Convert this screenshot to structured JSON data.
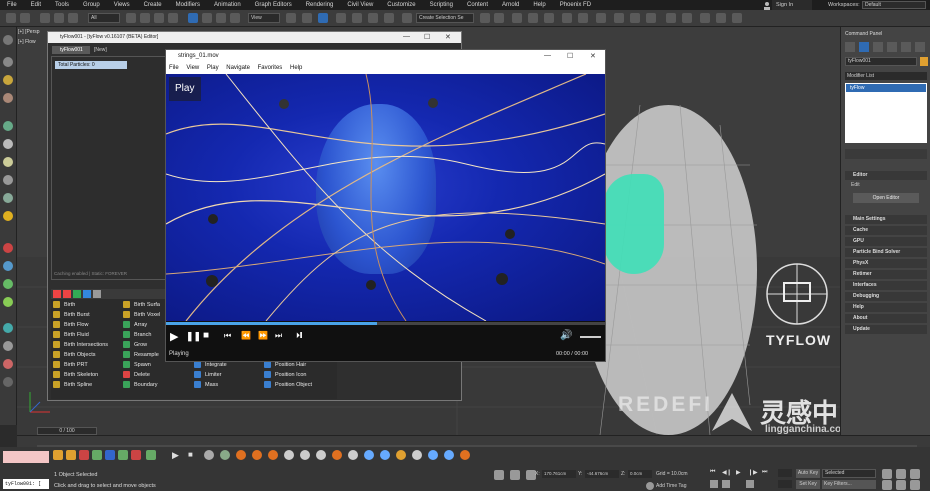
{
  "menubar": {
    "items": [
      "File",
      "Edit",
      "Tools",
      "Group",
      "Views",
      "Create",
      "Modifiers",
      "Animation",
      "Graph Editors",
      "Rendering",
      "Civil View",
      "Customize",
      "Scripting",
      "Content",
      "Arnold",
      "Help",
      "Phoenix FD"
    ],
    "signin": "Sign In",
    "workspaces_label": "Workspaces:",
    "workspaces_value": "Default"
  },
  "toolbar": {
    "filter_value": "All",
    "view_value": "View",
    "selection_set_placeholder": "Create Selection Se"
  },
  "viewport": {
    "label": "[+] [Persp",
    "flow_label": "[+] Flow"
  },
  "tyflow_editor": {
    "title": "tyFlow001 - [tyFlow v0.16107 (BETA) Editor]",
    "tab_active": "tyFlow001",
    "tab_new": "[New]",
    "total_particles": "Total Particles: 0",
    "status": "Caching enabled | Static: FOREVER",
    "operators_col1": [
      "Birth",
      "Birth Burst",
      "Birth Flow",
      "Birth Fluid",
      "Birth Intersections",
      "Birth Objects",
      "Birth PRT",
      "Birth Skeleton",
      "Birth Spline"
    ],
    "operators_col2": [
      "Birth Surfa",
      "Birth Voxel",
      "Array",
      "Branch",
      "Grow",
      "Resample",
      "Spawn",
      "Delete",
      "Boundary"
    ],
    "operators_col3": [
      "Integrate",
      "Limiter",
      "Mass"
    ],
    "operators_col4": [
      "Position Hair",
      "Position Icon",
      "Position Object"
    ]
  },
  "video_player": {
    "title": "strings_01.mov",
    "menu": [
      "File",
      "View",
      "Play",
      "Navigate",
      "Favorites",
      "Help"
    ],
    "overlay_label": "Play",
    "status": "Playing",
    "time": "00:00 / 00:00",
    "progress": 0.48,
    "volume": 1
  },
  "command_panel": {
    "title": "Command Panel",
    "object_name": "tyFlow001",
    "modifier_list_label": "Modifier List",
    "stack_item": "tyFlow",
    "rollouts": [
      "Editor",
      "Main Settings",
      "Cache",
      "GPU",
      "Particle Bind Solver",
      "PhysX",
      "Retimer",
      "Interfaces",
      "Debugging",
      "Help",
      "About",
      "Update"
    ],
    "editor_label": "Edit",
    "open_editor_button": "Open Editor"
  },
  "timeline": {
    "frame_display": "0 / 100"
  },
  "status_bar": {
    "script_listener": "tyFlow001: [",
    "selected_text": "1 Object Selected",
    "prompt": "Click and drag to select and move objects",
    "x_label": "X:",
    "x_value": "170.761cm",
    "y_label": "Y:",
    "y_value": "-44.676cm",
    "z_label": "Z:",
    "z_value": "0.0cm",
    "grid": "Grid = 10.0cm",
    "add_time_tag": "Add Time Tag",
    "auto_key": "Auto Key",
    "set_key": "Set Key",
    "selected_dropdown": "Selected",
    "key_filters": "Key Filters..."
  },
  "watermark": {
    "logo_text": "TYFLOW",
    "redef": "REDEFI",
    "cn_text": "灵感中国",
    "site": "lingganchina.com"
  },
  "colors": {
    "accent_blue": "#2f6bb3",
    "video_bg": "#0c1a8a",
    "teal": "#3fe0b8"
  }
}
